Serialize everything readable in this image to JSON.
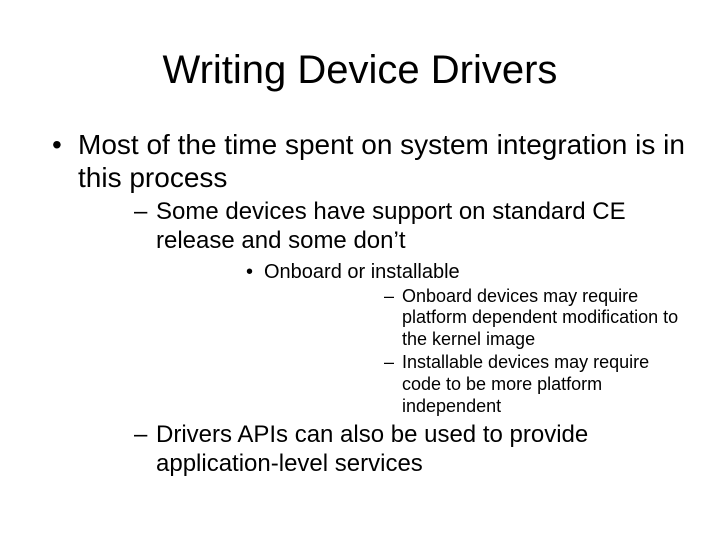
{
  "title": "Writing Device Drivers",
  "bullets": {
    "lvl1_0": "Most of the time spent on system integration is in this process",
    "lvl2_0": "Some devices have support on standard CE release and some don’t",
    "lvl3_0": "Onboard or installable",
    "lvl4_0": "Onboard devices may require platform dependent modification to the kernel image",
    "lvl4_1": "Installable devices may require code to be more platform independent",
    "lvl2_1": "Drivers APIs can also be used to provide application-level services"
  }
}
